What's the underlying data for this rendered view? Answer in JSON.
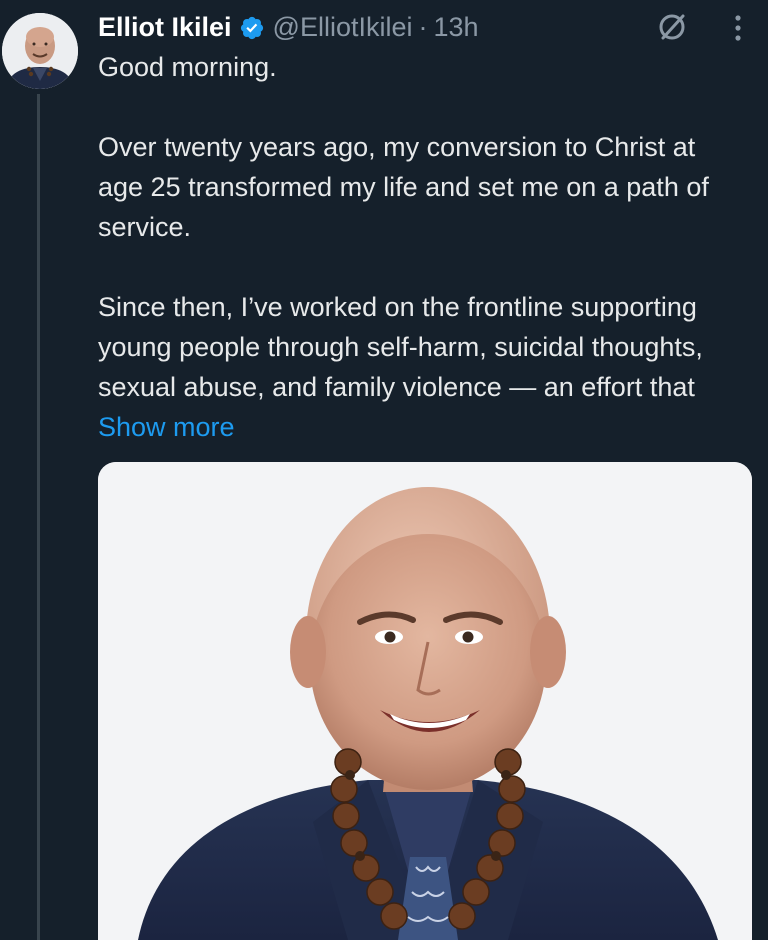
{
  "author": {
    "display_name": "Elliot Ikilei",
    "handle": "@ElliotIkilei",
    "separator": "·",
    "time": "13h",
    "verified": true
  },
  "tweet": {
    "line1": "Good morning.",
    "para2": "Over twenty years ago, my conversion to Christ at age 25 transformed my life and set me on a path of service.",
    "para3": "Since then, I’ve worked on the frontline supporting young people through self-harm, suicidal thoughts, sexual abuse, and family violence — an effort that",
    "show_more": "Show more"
  },
  "icons": {
    "verified": "verified-badge-icon",
    "grok": "grok-icon",
    "more": "more-options-icon"
  },
  "colors": {
    "background": "#15202b",
    "text": "#e7e9ea",
    "muted": "#8b98a5",
    "link": "#1d9bf0",
    "verified": "#1d9bf0"
  }
}
